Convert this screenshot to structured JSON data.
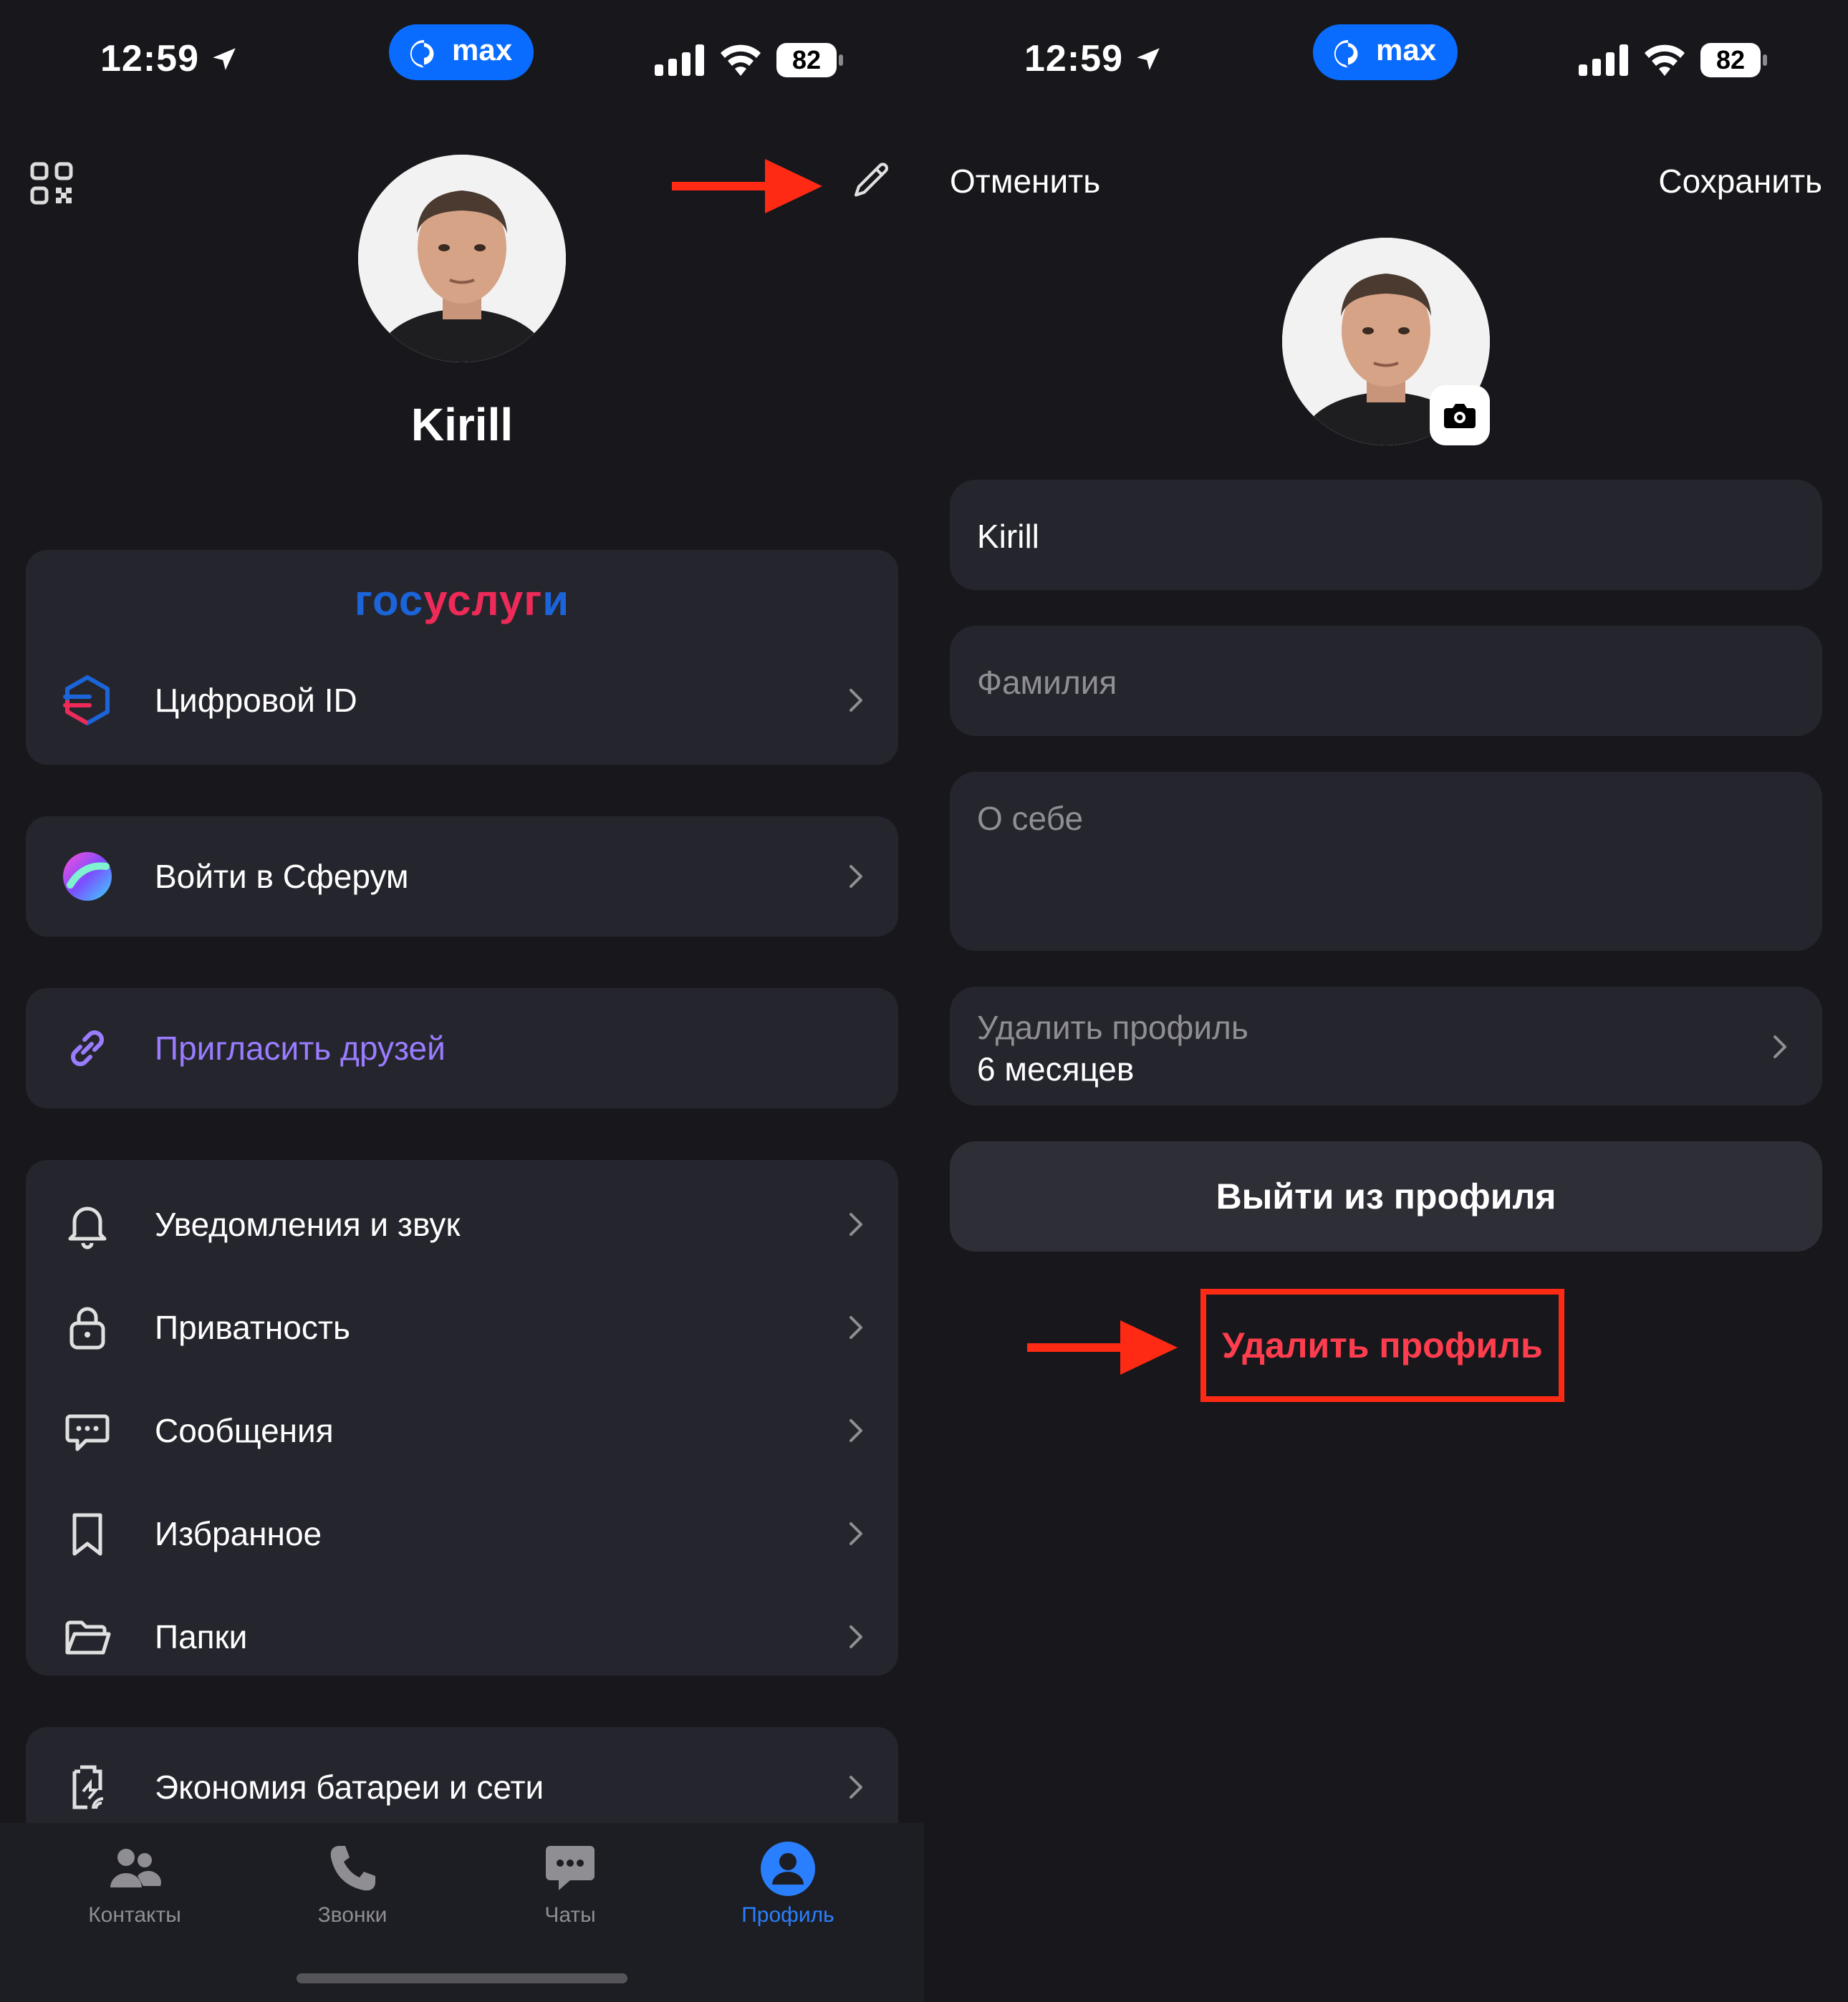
{
  "status_bar": {
    "time": "12:59",
    "app_pill": "max",
    "battery": "82"
  },
  "left": {
    "profile_name": "Kirill",
    "gosuslugi": {
      "part1": "гос",
      "part2": "услуг",
      "part3": "и"
    },
    "digital_id": "Цифровой ID",
    "sferum": "Войти в Сферум",
    "invite": "Пригласить друзей",
    "settings": [
      {
        "label": "Уведомления и звук",
        "icon": "bell-icon"
      },
      {
        "label": "Приватность",
        "icon": "lock-icon"
      },
      {
        "label": "Сообщения",
        "icon": "message-icon"
      },
      {
        "label": "Избранное",
        "icon": "bookmark-icon"
      },
      {
        "label": "Папки",
        "icon": "folder-icon"
      }
    ],
    "economy": "Экономия батареи и сети",
    "tabs": [
      {
        "label": "Контакты",
        "icon": "contacts-icon"
      },
      {
        "label": "Звонки",
        "icon": "phone-icon"
      },
      {
        "label": "Чаты",
        "icon": "chats-icon"
      },
      {
        "label": "Профиль",
        "icon": "profile-icon",
        "active": true
      }
    ]
  },
  "right": {
    "cancel": "Отменить",
    "save": "Сохранить",
    "first_name": "Kirill",
    "last_name_placeholder": "Фамилия",
    "about_placeholder": "О себе",
    "delete_profile_label": "Удалить профиль",
    "delete_profile_value": "6 месяцев",
    "logout": "Выйти из профиля",
    "delete_link": "Удалить профиль"
  },
  "colors": {
    "background": "#18181c",
    "card": "#25262d",
    "accent_blue": "#2a7fff",
    "invite_purple": "#9a7cff",
    "danger": "#ff3d4e",
    "annotation_red": "#ff2a14"
  }
}
